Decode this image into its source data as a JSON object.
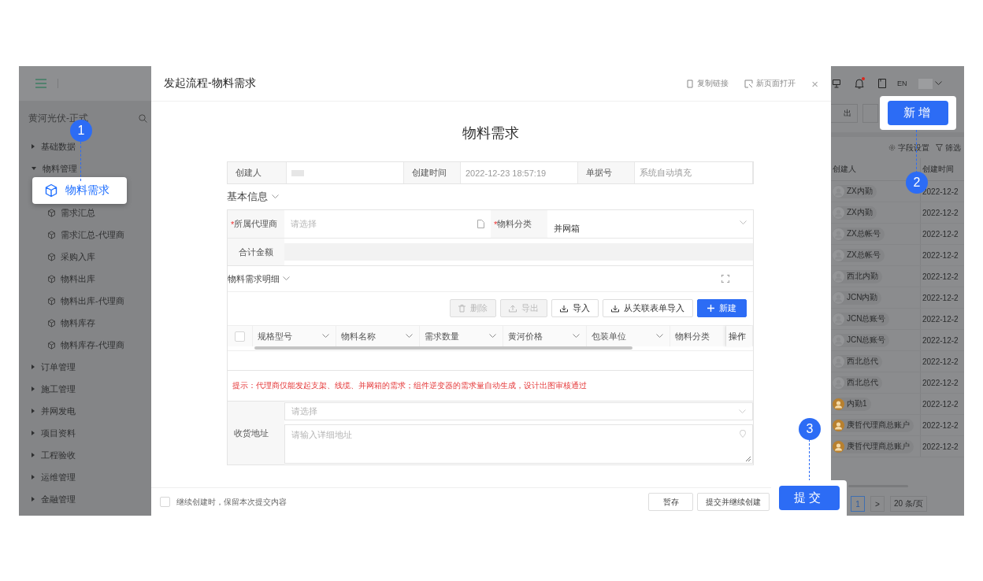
{
  "app_header": {
    "language": "EN",
    "notification": true
  },
  "sidebar": {
    "org": "黄河光伏-正式",
    "items": [
      {
        "label": "基础数据",
        "expanded": false
      },
      {
        "label": "物料管理",
        "expanded": true,
        "children": [
          {
            "label": "物料需求",
            "highlighted": true
          },
          {
            "label": "需求汇总",
            "highlighted": false
          },
          {
            "label": "需求汇总-代理商",
            "highlighted": false
          },
          {
            "label": "采购入库",
            "highlighted": false
          },
          {
            "label": "物料出库",
            "highlighted": false
          },
          {
            "label": "物料出库-代理商",
            "highlighted": false
          },
          {
            "label": "物料库存",
            "highlighted": false
          },
          {
            "label": "物料库存-代理商",
            "highlighted": false
          }
        ]
      },
      {
        "label": "订单管理",
        "expanded": false
      },
      {
        "label": "施工管理",
        "expanded": false
      },
      {
        "label": "并网发电",
        "expanded": false
      },
      {
        "label": "项目资料",
        "expanded": false
      },
      {
        "label": "工程验收",
        "expanded": false
      },
      {
        "label": "运维管理",
        "expanded": false
      },
      {
        "label": "金融管理",
        "expanded": false
      }
    ]
  },
  "background_list": {
    "toolbar_button": "出",
    "tools": [
      {
        "label": "字段设置",
        "kind": "settings"
      },
      {
        "label": "筛选",
        "kind": "filter"
      }
    ],
    "columns": [
      "创建人",
      "创建时间"
    ],
    "rows": [
      {
        "creator": "ZX内勤",
        "custom_avatar": false,
        "created": "2022-12-2"
      },
      {
        "creator": "ZX内勤",
        "custom_avatar": false,
        "created": "2022-12-2"
      },
      {
        "creator": "ZX总帐号",
        "custom_avatar": false,
        "created": "2022-12-2"
      },
      {
        "creator": "ZX总帐号",
        "custom_avatar": false,
        "created": "2022-12-2"
      },
      {
        "creator": "西北内勤",
        "custom_avatar": false,
        "created": "2022-12-2"
      },
      {
        "creator": "JCN内勤",
        "custom_avatar": false,
        "created": "2022-12-2"
      },
      {
        "creator": "JCN总账号",
        "custom_avatar": false,
        "created": "2022-12-2"
      },
      {
        "creator": "JCN总账号",
        "custom_avatar": false,
        "created": "2022-12-2"
      },
      {
        "creator": "西北总代",
        "custom_avatar": false,
        "created": "2022-12-2"
      },
      {
        "creator": "西北总代",
        "custom_avatar": false,
        "created": "2022-12-2"
      },
      {
        "creator": "内勤1",
        "custom_avatar": true,
        "created": "2022-12-2"
      },
      {
        "creator": "庚哲代理商总账户",
        "custom_avatar": true,
        "created": "2022-12-2"
      },
      {
        "creator": "庚哲代理商总账户",
        "custom_avatar": true,
        "created": "2022-12-2"
      }
    ],
    "pagination": {
      "page": "1",
      "next": ">",
      "page_size": "20 条/页"
    }
  },
  "modal": {
    "title": "发起流程-物料需求",
    "actions": [
      {
        "label": "复制链接",
        "kind": "copy"
      },
      {
        "label": "新页面打开",
        "kind": "open"
      }
    ],
    "close": "×",
    "form_title": "物料需求",
    "info": {
      "creator_label": "创建人",
      "time_label": "创建时间",
      "time": "2022-12-23 18:57:19",
      "number_label": "单据号",
      "number_placeholder": "系统自动填充"
    },
    "basic_section": "基本信息",
    "fields": {
      "agent": {
        "required_mark": "*",
        "label": "所属代理商",
        "placeholder": "请选择"
      },
      "category": {
        "required_mark": "*",
        "label": "物料分类",
        "value": "并网箱"
      },
      "total": {
        "label": "合计金额",
        "disabled": true
      }
    },
    "detail_section": "物料需求明细",
    "detail_buttons": [
      {
        "label": "删除",
        "kind": "delete",
        "disabled": true
      },
      {
        "label": "导出",
        "kind": "export",
        "disabled": true
      },
      {
        "label": "导入",
        "kind": "import",
        "disabled": false
      },
      {
        "label": "从关联表单导入",
        "kind": "import",
        "disabled": false
      },
      {
        "label": "新建",
        "kind": "create",
        "disabled": false
      }
    ],
    "select_all": {
      "checked": false
    },
    "detail_columns": [
      {
        "label": "规格型号",
        "dropdown": true
      },
      {
        "label": "物料名称",
        "dropdown": true
      },
      {
        "label": "需求数量",
        "dropdown": true
      },
      {
        "label": "黄河价格",
        "dropdown": true
      },
      {
        "label": "包装单位",
        "dropdown": true
      },
      {
        "label": "物料分类",
        "dropdown": false
      },
      {
        "label": "操作",
        "dropdown": false
      }
    ],
    "hint": "提示：代理商仅能发起支架、线缆、并网箱的需求；组件逆变器的需求量自动生成，设计出图审核通过",
    "address": {
      "label": "收货地址",
      "region_placeholder": "请选择",
      "detail_placeholder": "请输入详细地址"
    },
    "footer": {
      "keep": {
        "label": "继续创建时，保留本次提交内容",
        "checked": false
      },
      "buttons": [
        "暂存",
        "提交并继续创建"
      ]
    }
  },
  "steps": [
    {
      "number": "1",
      "kind": "menu"
    },
    {
      "number": "2",
      "kind": "button",
      "label": "新增"
    },
    {
      "number": "3",
      "kind": "button",
      "label": "提交"
    }
  ]
}
